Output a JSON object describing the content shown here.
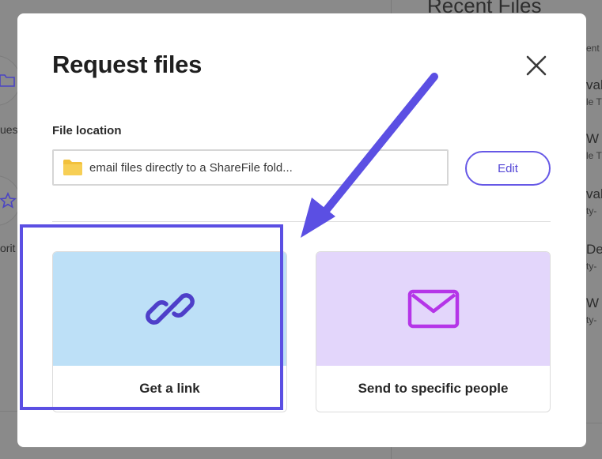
{
  "background": {
    "recent_files_title": "Recent Files",
    "tools": [
      {
        "label": "uest"
      },
      {
        "label": "orit"
      }
    ],
    "files": [
      {
        "title": "",
        "sub": "ent"
      },
      {
        "title": "val",
        "sub": "le T"
      },
      {
        "title": "W",
        "sub": "le T"
      },
      {
        "title": "val",
        "sub": "ty-"
      },
      {
        "title": "Der",
        "sub": "ty-"
      },
      {
        "title": "W",
        "sub": "ty-"
      }
    ]
  },
  "modal": {
    "title": "Request files",
    "close_icon": "close-icon",
    "file_location": {
      "label": "File location",
      "value": "email files directly to a ShareFile fold...",
      "folder_icon": "folder-icon",
      "folder_color": "#F2C13C"
    },
    "edit_label": "Edit",
    "options": [
      {
        "label": "Get a link",
        "icon": "link-icon",
        "bg": "#BDE0F7",
        "icon_color": "#4E3FC9"
      },
      {
        "label": "Send to specific people",
        "icon": "envelope-icon",
        "bg": "#E3D6FB",
        "icon_color": "#B535E8"
      }
    ]
  },
  "annotation": {
    "color": "#5B4FE3",
    "target": "Get a link"
  }
}
